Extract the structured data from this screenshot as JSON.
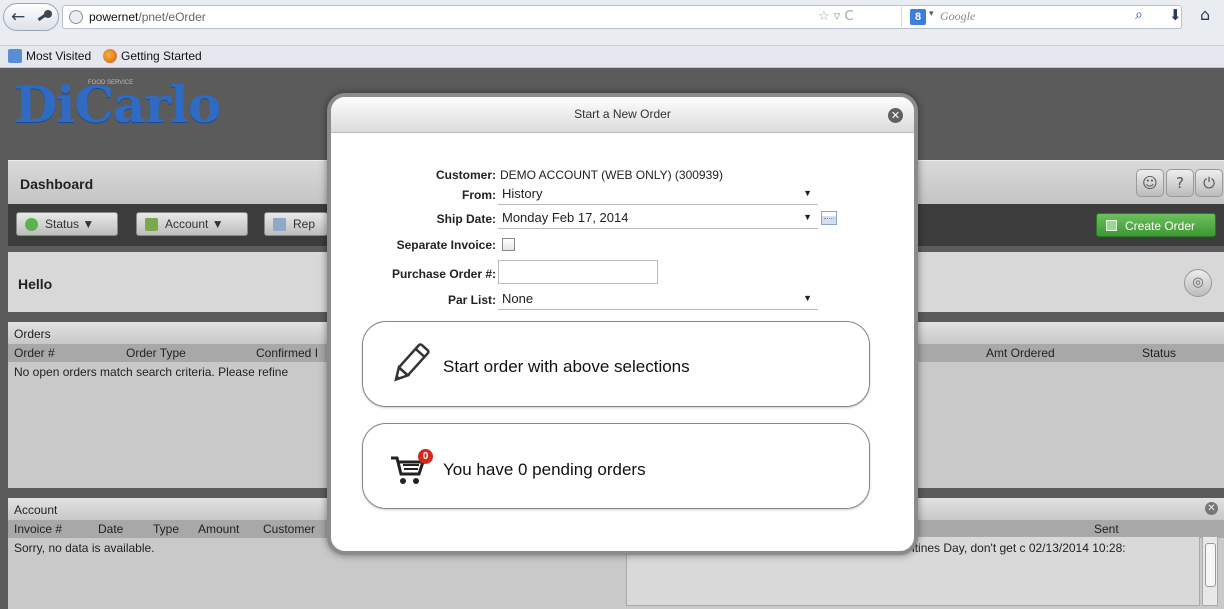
{
  "browser": {
    "url_host": "powernet",
    "url_path": "/pnet/eOrder",
    "search_placeholder": "Google",
    "search_engine_letter": "8",
    "bookmarks": [
      "Most Visited",
      "Getting Started"
    ]
  },
  "app": {
    "logo": "DiCarlo",
    "logo_sub": "FOOD SERVICE",
    "dashboard_title": "Dashboard",
    "toolbar_icons": [
      "user-icon",
      "help-icon",
      "power-icon"
    ],
    "menu": {
      "status": "Status ▼",
      "account": "Account ▼",
      "reports": "Rep",
      "create_order": "Create Order"
    },
    "hello": "Hello",
    "orders_panel": {
      "title": "Orders",
      "columns": [
        "Order #",
        "Order Type",
        "Confirmed I"
      ],
      "empty_text": "No open orders match search criteria. Please refine",
      "right_columns": [
        "Amt Ordered",
        "Status"
      ]
    },
    "account_panel": {
      "title": "Account",
      "columns": [
        "Invoice #",
        "Date",
        "Type",
        "Amount",
        "Customer"
      ],
      "empty_text": "Sorry, no data is available."
    },
    "messages_panel": {
      "sent_col": "Sent",
      "message_row": "Valentines LPlease remember this week end is Valentines Day, don't get c 02/13/2014 10:28:"
    }
  },
  "modal": {
    "title": "Start a New Order",
    "customer_label": "Customer:",
    "customer_value": "DEMO ACCOUNT (WEB ONLY) (300939)",
    "from_label": "From:",
    "from_value": "History",
    "ship_date_label": "Ship Date:",
    "ship_date_value": "Monday Feb 17, 2014",
    "separate_invoice_label": "Separate Invoice:",
    "separate_invoice_checked": false,
    "po_label": "Purchase Order #:",
    "po_value": "",
    "par_list_label": "Par List:",
    "par_list_value": "None",
    "start_order_text": "Start order with above selections",
    "pending_text": "You have 0 pending orders",
    "pending_count": "0"
  }
}
